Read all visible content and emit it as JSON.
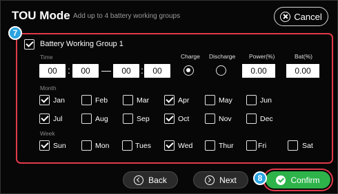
{
  "header": {
    "title": "TOU Mode",
    "subtitle": "Add up to 4 battery working groups",
    "cancel_label": "Cancel"
  },
  "markers": {
    "group": "7",
    "confirm": "8"
  },
  "group": {
    "label": "Battery Working Group 1",
    "checked": true,
    "time_label": "Time",
    "start_hour": "00",
    "start_min": "00",
    "end_hour": "00",
    "end_min": "00",
    "charge_label": "Charge",
    "discharge_label": "Discharge",
    "power_label": "Power(%)",
    "bat_label": "Bat(%)",
    "mode_selected": "Charge",
    "power_value": "0.00",
    "bat_value": "0.00"
  },
  "month_label": "Month",
  "months": [
    {
      "label": "Jan",
      "checked": true
    },
    {
      "label": "Feb",
      "checked": false
    },
    {
      "label": "Mar",
      "checked": false
    },
    {
      "label": "Apr",
      "checked": true
    },
    {
      "label": "May",
      "checked": false
    },
    {
      "label": "Jun",
      "checked": false
    },
    {
      "label": "Jul",
      "checked": true
    },
    {
      "label": "Aug",
      "checked": false
    },
    {
      "label": "Sep",
      "checked": false
    },
    {
      "label": "Oct",
      "checked": true
    },
    {
      "label": "Nov",
      "checked": false
    },
    {
      "label": "Dec",
      "checked": false
    }
  ],
  "week_label": "Week",
  "weekdays": [
    {
      "label": "Sun",
      "checked": true
    },
    {
      "label": "Mon",
      "checked": false
    },
    {
      "label": "Tues",
      "checked": false
    },
    {
      "label": "Wed",
      "checked": true
    },
    {
      "label": "Thur",
      "checked": false
    },
    {
      "label": "Fri",
      "checked": false
    },
    {
      "label": "Sat",
      "checked": false
    }
  ],
  "footer": {
    "back_label": "Back",
    "next_label": "Next",
    "confirm_label": "Confirm"
  },
  "colors": {
    "highlight": "#e23a4a",
    "marker": "#2aa3e0",
    "confirm": "#2db34a",
    "background": "#070707"
  }
}
